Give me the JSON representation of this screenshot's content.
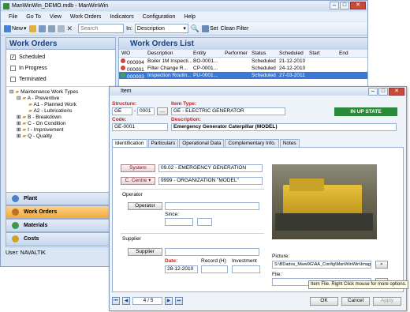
{
  "app": {
    "title": "ManWinWin_DEMO.mdb - ManWinWin"
  },
  "menu": [
    "File",
    "Go To",
    "View",
    "Work Orders",
    "Indicators",
    "Configuration",
    "Help"
  ],
  "toolbar": {
    "new_label": "New",
    "search_placeholder": "Search",
    "in_label": "In:",
    "in_value": "Description",
    "set_label": "Set",
    "clear_label": "Clean Filter"
  },
  "left": {
    "title": "Work Orders",
    "filters": [
      {
        "label": "Scheduled",
        "checked": true
      },
      {
        "label": "In Progress",
        "checked": false
      },
      {
        "label": "Terminated",
        "checked": false
      }
    ],
    "tree": [
      "Maintenance Work Types",
      "A - Preventive",
      "A1 - Planned Work",
      "A2 - Lubrications",
      "B - Breakdown",
      "C - On Condition",
      "I - Improvement",
      "Q - Quality"
    ],
    "nav": [
      "Plant",
      "Work Orders",
      "Materials",
      "Costs"
    ],
    "status": "User: NAVALTIK"
  },
  "list": {
    "title": "Work Orders List",
    "columns": [
      "WO",
      "Description",
      "Entity",
      "Performer",
      "Status",
      "Scheduled",
      "Start",
      "End"
    ],
    "rows": [
      {
        "wo": "000004",
        "description": "Boiler 1M Inspecti...",
        "entity": "BO-0001...",
        "performer": "",
        "status": "Scheduled",
        "scheduled": "21-12-2010",
        "dot": "#d84040",
        "selected": false
      },
      {
        "wo": "000001",
        "description": "Filter Change R...",
        "entity": "CP-0001...",
        "performer": "",
        "status": "Scheduled",
        "scheduled": "24-12-2010",
        "dot": "#d84040",
        "selected": false
      },
      {
        "wo": "000003",
        "description": "Inspection Routin...",
        "entity": "PU-0001...",
        "performer": "",
        "status": "Scheduled",
        "scheduled": "27-03-2011",
        "dot": "#3aaa3a",
        "selected": true
      }
    ]
  },
  "dialog": {
    "title": "Item",
    "structure_label": "Structure:",
    "structure_code": "GE",
    "structure_num": "0001",
    "item_type_label": "Item Type:",
    "item_type_value": "GE - ELECTRIC GENERATOR",
    "state": "IN UP STATE",
    "code_label": "Code:",
    "code_value": "GE-0001",
    "desc_label": "Description:",
    "desc_value": "Emergency Generator Caterpillar (MODEL)",
    "tabs": [
      "Identification",
      "Particulars",
      "Operational Data",
      "Complementary Info.",
      "Notes"
    ],
    "system_btn": "System",
    "system_value": "09.02 - EMERGENCY GENERATION",
    "ccentre_btn": "C. Centre",
    "ccentre_value": "9999 - ORGANIZATION \"MODEL\"",
    "operator_group": "Operator",
    "operator_btn": "Operator",
    "since_label": "Since:",
    "supplier_group": "Supplier",
    "supplier_btn": "Supplier",
    "date_label": "Date:",
    "date_value": "28-12-2010",
    "record_label": "Record (H)",
    "investment_label": "Investment",
    "picture_label": "Picture:",
    "picture_path": "S:\\BDados_Mww9G\\AA_Config\\ManWinWin\\Images\\",
    "file_label": "File:",
    "tooltip": "Item File. Right Click mouse for more options.",
    "pager": "4 / 5",
    "ok": "OK",
    "cancel": "Cancel",
    "apply": "Apply"
  }
}
